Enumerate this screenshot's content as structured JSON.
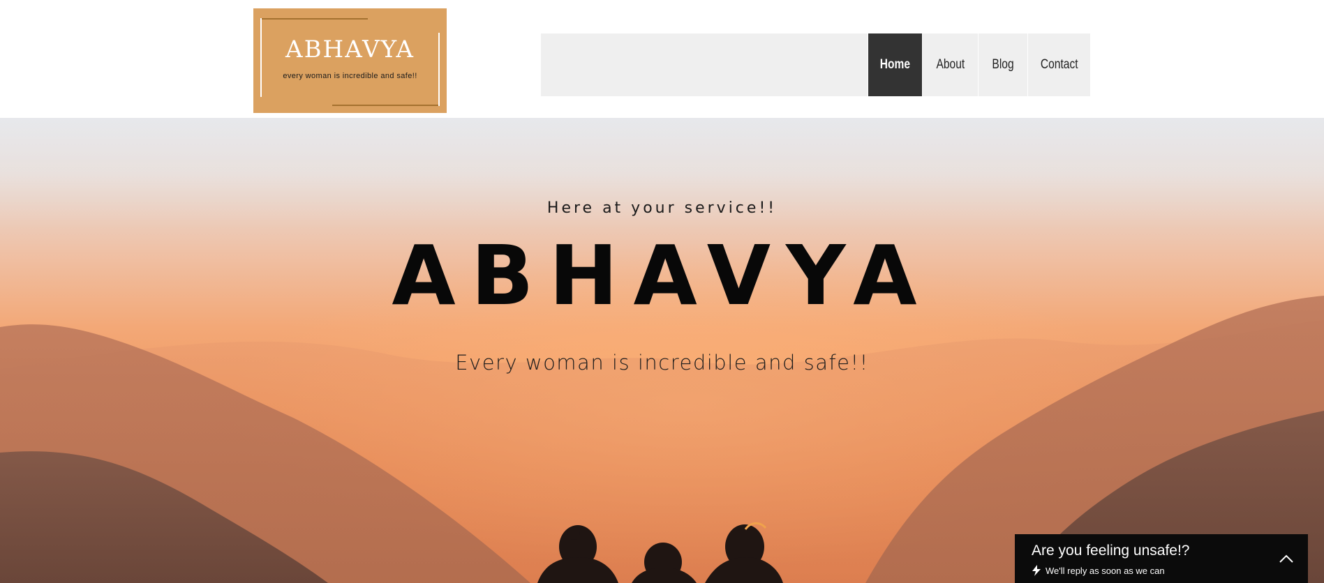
{
  "logo": {
    "title": "ABHAVYA",
    "tagline": "every woman is incredible and safe!!",
    "bg_color": "#dba160"
  },
  "nav": {
    "items": [
      {
        "label": "Home",
        "active": true
      },
      {
        "label": "About",
        "active": false
      },
      {
        "label": "Blog",
        "active": false
      },
      {
        "label": "Contact",
        "active": false
      }
    ]
  },
  "hero": {
    "kicker": "Here at your service!!",
    "title": "ABHAVYA",
    "tagline": "Every woman is incredible and safe!!",
    "image": "sunset-mountains-silhouettes"
  },
  "chat_widget": {
    "title": "Are you feeling unsafe!?",
    "subtitle": "We'll reply as soon as we can",
    "icons": [
      "bolt-icon",
      "chevron-up-icon"
    ]
  },
  "colors": {
    "nav_active_bg": "#333333",
    "nav_bg": "#efefef",
    "chat_bg": "#0b0b0b"
  }
}
